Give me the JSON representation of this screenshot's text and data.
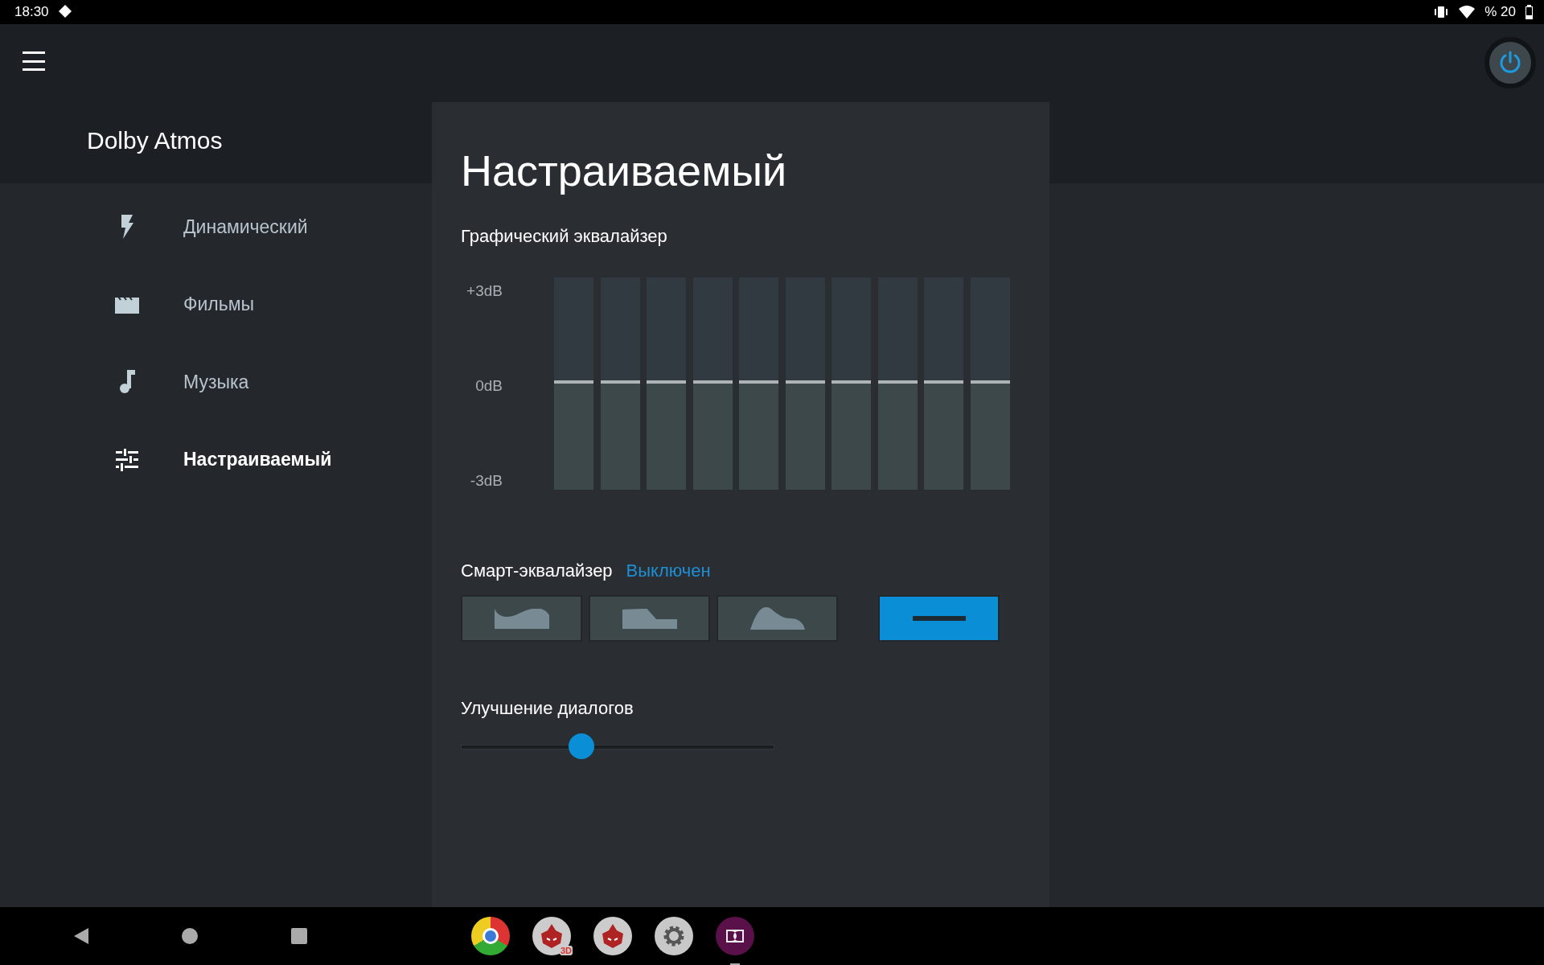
{
  "status_bar": {
    "time": "18:30",
    "battery": "% 20"
  },
  "app_title": "Dolby Atmos",
  "power": {
    "on": true
  },
  "profiles": [
    {
      "kind": "bolt",
      "label": "Динамический",
      "selected": false
    },
    {
      "kind": "film",
      "label": "Фильмы",
      "selected": false
    },
    {
      "kind": "music",
      "label": "Музыка",
      "selected": false
    },
    {
      "kind": "tune",
      "label": "Настраиваемый",
      "selected": true
    }
  ],
  "panel": {
    "title": "Настраиваемый",
    "graphic_eq": {
      "title": "Графический эквалайзер",
      "scale": [
        "+3dB",
        "0dB",
        "-3dB"
      ],
      "bands": [
        {
          "level": 0.5
        },
        {
          "level": 0.5
        },
        {
          "level": 0.5
        },
        {
          "level": 0.5
        },
        {
          "level": 0.5
        },
        {
          "level": 0.5
        },
        {
          "level": 0.5
        },
        {
          "level": 0.5
        },
        {
          "level": 0.5
        },
        {
          "level": 0.5
        }
      ]
    },
    "smart_eq": {
      "label": "Смарт-эквалайзер",
      "status": "Выключен",
      "presets": [
        {
          "kind": "open",
          "selected": false
        },
        {
          "kind": "rich",
          "selected": false
        },
        {
          "kind": "focused",
          "selected": false
        },
        {
          "kind": "flat",
          "selected": true
        }
      ]
    },
    "dialogue": {
      "label": "Улучшение диалогов",
      "level": 0.385
    }
  },
  "nav_bar": {
    "apps": [
      {
        "kind": "chrome",
        "running": false
      },
      {
        "kind": "benchmark",
        "badge": "3D",
        "running": false
      },
      {
        "kind": "benchmark",
        "running": false
      },
      {
        "kind": "settings",
        "running": false
      },
      {
        "kind": "dolby",
        "running": true
      }
    ]
  }
}
